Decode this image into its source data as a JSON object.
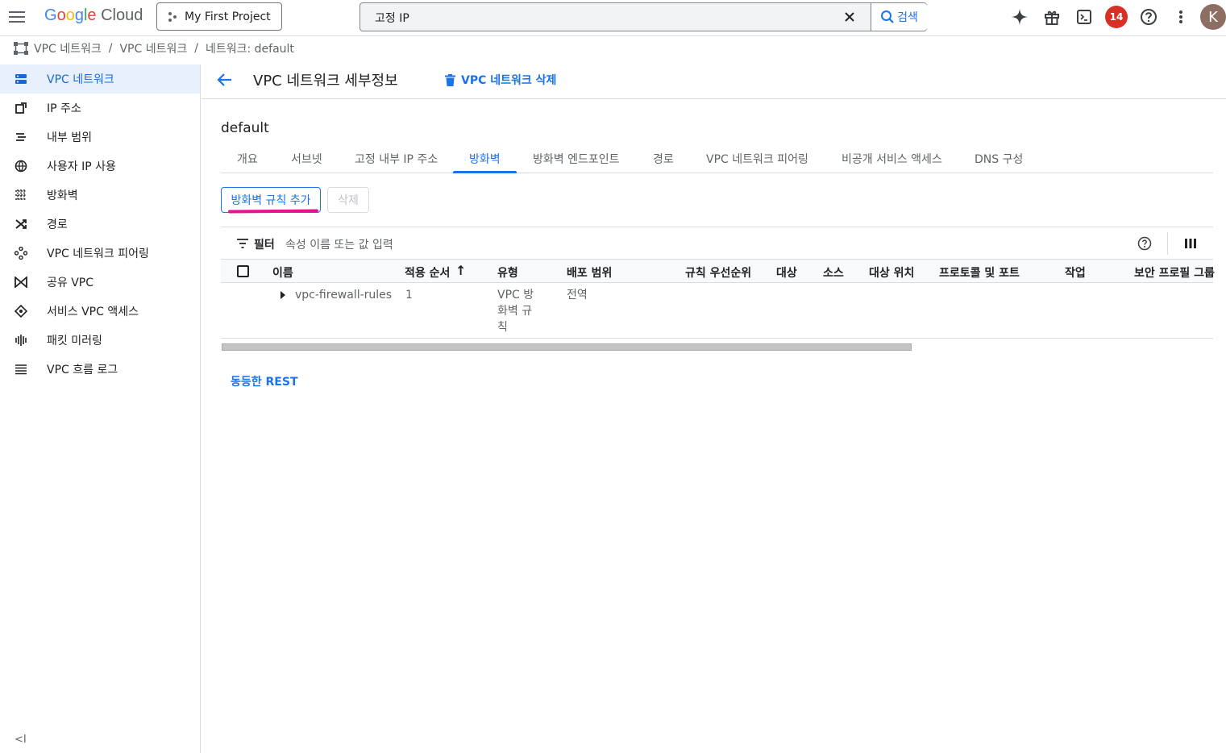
{
  "topbar": {
    "logo_google": "Google",
    "logo_cloud": "Cloud",
    "project": "My First Project",
    "search_value": "고정 IP",
    "search_button": "검색",
    "notification_count": "14",
    "avatar_letter": "K"
  },
  "breadcrumb": {
    "items": [
      "VPC 네트워크",
      "VPC 네트워크",
      "네트워크: default"
    ],
    "separator": "/"
  },
  "sidebar": {
    "items": [
      {
        "label": "VPC 네트워크",
        "icon": "vpc-network-icon"
      },
      {
        "label": "IP 주소",
        "icon": "ip-address-icon"
      },
      {
        "label": "내부 범위",
        "icon": "internal-range-icon"
      },
      {
        "label": "사용자 IP 사용",
        "icon": "globe-icon"
      },
      {
        "label": "방화벽",
        "icon": "firewall-icon"
      },
      {
        "label": "경로",
        "icon": "routes-icon"
      },
      {
        "label": "VPC 네트워크 피어링",
        "icon": "peering-icon"
      },
      {
        "label": "공유 VPC",
        "icon": "shared-vpc-icon"
      },
      {
        "label": "서비스 VPC 액세스",
        "icon": "service-vpc-icon"
      },
      {
        "label": "패킷 미러링",
        "icon": "packet-mirroring-icon"
      },
      {
        "label": "VPC 흐름 로그",
        "icon": "flow-logs-icon"
      }
    ],
    "collapse": "<I"
  },
  "header": {
    "title": "VPC 네트워크 세부정보",
    "delete_label": "VPC 네트워크 삭제"
  },
  "network_name": "default",
  "tabs": [
    "개요",
    "서브넷",
    "고정 내부 IP 주소",
    "방화벽",
    "방화벽 엔드포인트",
    "경로",
    "VPC 네트워크 피어링",
    "비공개 서비스 액세스",
    "DNS 구성"
  ],
  "actions": {
    "add_rule": "방화벽 규칙 추가",
    "delete": "삭제"
  },
  "filter": {
    "label": "필터",
    "placeholder": "속성 이름 또는 값 입력"
  },
  "table": {
    "columns": [
      "이름",
      "적용 순서",
      "유형",
      "배포 범위",
      "규칙 우선순위",
      "대상",
      "소스",
      "대상 위치",
      "프로토콜 및 포트",
      "작업",
      "보안 프로필 그룹"
    ],
    "sort_indicator": "↑",
    "rows": [
      {
        "name": "vpc-firewall-rules",
        "order": "1",
        "type_line1": "VPC 방",
        "type_line2": "화벽 규",
        "type_line3": "칙",
        "scope": "전역"
      }
    ]
  },
  "rest_link": "동등한 REST",
  "colors": {
    "accent": "#1a73e8",
    "highlight": "#e8128c",
    "badge": "#d93025"
  }
}
